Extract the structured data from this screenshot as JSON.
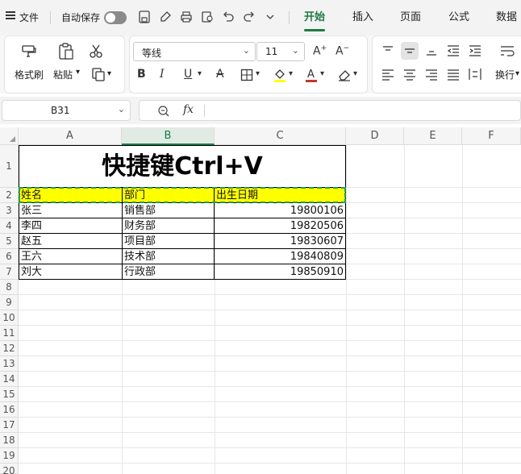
{
  "menubar": {
    "file_label": "文件",
    "autosave_label": "自动保存",
    "tabs": [
      "开始",
      "插入",
      "页面",
      "公式",
      "数据"
    ],
    "active_tab": "开始"
  },
  "ribbon": {
    "format_painter": "格式刷",
    "paste": "粘贴",
    "font_name": "等线",
    "font_size": "11",
    "wrap": "换行"
  },
  "formula_bar": {
    "name_box": "B31",
    "fx": "fx"
  },
  "sheet": {
    "columns": [
      "A",
      "B",
      "C",
      "D",
      "E",
      "F"
    ],
    "selected_column": "B",
    "rows": [
      "1",
      "2",
      "3",
      "4",
      "5",
      "6",
      "7",
      "8",
      "9",
      "10",
      "11",
      "12",
      "13",
      "14",
      "15",
      "16",
      "17",
      "18",
      "19",
      "20"
    ],
    "title": "快捷键Ctrl+V",
    "headers": [
      "姓名",
      "部门",
      "出生日期"
    ],
    "data": [
      [
        "张三",
        "销售部",
        "19800106"
      ],
      [
        "李四",
        "财务部",
        "19820506"
      ],
      [
        "赵五",
        "项目部",
        "19830607"
      ],
      [
        "王六",
        "技术部",
        "19840809"
      ],
      [
        "刘大",
        "行政部",
        "19850910"
      ]
    ]
  },
  "colors": {
    "accent": "#1e7b45",
    "highlight": "#ffff00",
    "marquee": "#1e9e55"
  }
}
